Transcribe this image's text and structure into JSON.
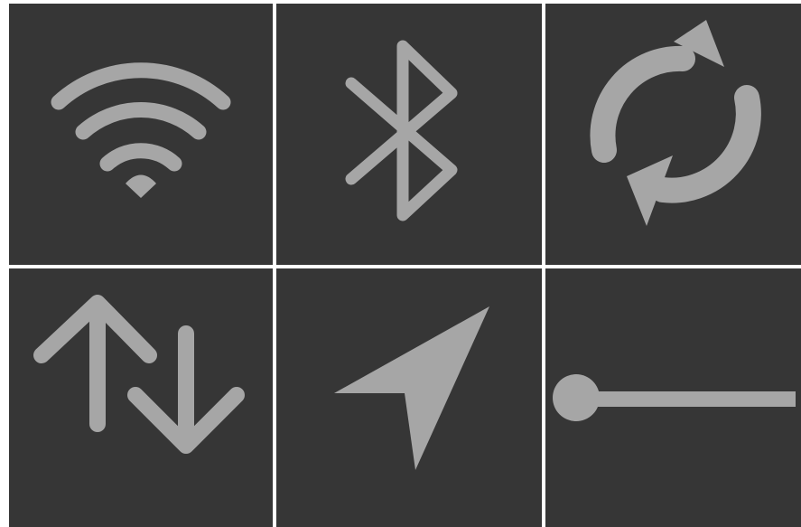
{
  "colors": {
    "background": "#ffffff",
    "tile": "#363636",
    "icon": "#a6a6a6"
  },
  "tiles": [
    {
      "icon": "wifi-icon"
    },
    {
      "icon": "bluetooth-icon"
    },
    {
      "icon": "sync-icon"
    },
    {
      "icon": "data-transfer-icon"
    },
    {
      "icon": "location-arrow-icon"
    },
    {
      "icon": "slider-icon"
    }
  ]
}
